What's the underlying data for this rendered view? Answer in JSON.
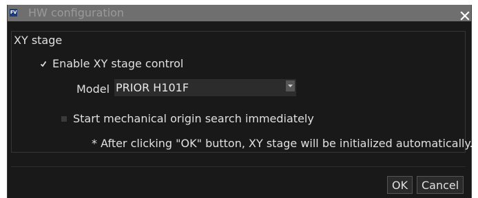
{
  "window": {
    "title": "HW configuration",
    "app_icon_text": "FV"
  },
  "group": {
    "title": "XY stage"
  },
  "enable_control": {
    "label": "Enable XY stage control",
    "checked": true
  },
  "model": {
    "label": "Model",
    "value": "PRIOR H101F"
  },
  "origin_search": {
    "label": "Start mechanical origin search immediately",
    "checked": false
  },
  "note": "* After clicking \"OK\" button, XY stage will be initialized automatically.",
  "buttons": {
    "ok": "OK",
    "cancel": "Cancel"
  },
  "colors": {
    "background": "#191919",
    "titlebar": "#6f6f6f",
    "text": "#e0e0e0"
  }
}
